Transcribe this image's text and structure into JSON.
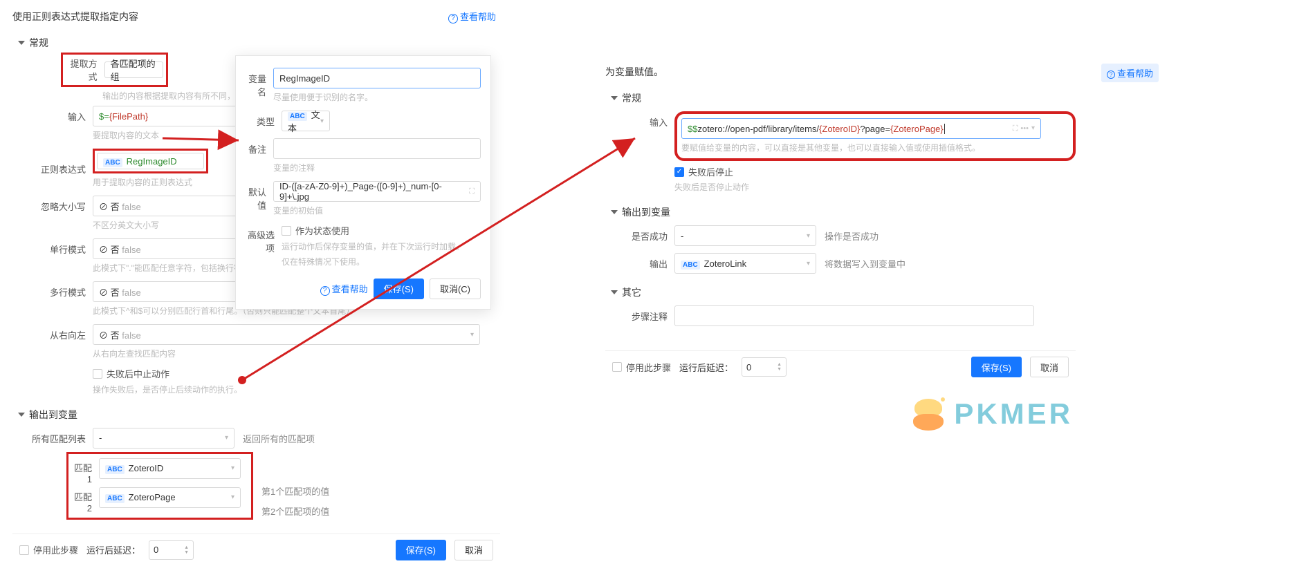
{
  "left": {
    "title": "使用正则表达式提取指定内容",
    "help": "查看帮助",
    "sec_general": "常规",
    "extract_mode_label": "提取方式",
    "extract_mode_value": "各匹配项的组",
    "extract_mode_hint": "输出的内容根据提取内容有所不同，请参考说明",
    "input_label": "输入",
    "input_prefix": "$=",
    "input_var": "{FilePath}",
    "input_hint": "要提取内容的文本",
    "regex_label": "正则表达式",
    "regex_badge": "ABC",
    "regex_value": "RegImageID",
    "regex_hint": "用于提取内容的正则表达式",
    "ignorecase_label": "忽略大小写",
    "val_no": "否",
    "val_false": "false",
    "ignorecase_hint": "不区分英文大小写",
    "singleline_label": "单行模式",
    "singleline_hint": "此模式下\".\"能匹配任意字符，包括换行符。",
    "multiline_label": "多行模式",
    "multiline_hint": "此模式下^和$可以分别匹配行首和行尾。（否则只能匹配整个文本首尾）",
    "rtl_label": "从右向左",
    "rtl_hint": "从右向左查找匹配内容",
    "stop_on_fail": "失败后中止动作",
    "stop_on_fail_hint": "操作失败后，是否停止后续动作的执行。",
    "sec_output": "输出到变量",
    "allmatch_label": "所有匹配列表",
    "allmatch_value": "-",
    "allmatch_hint": "返回所有的匹配项",
    "match1_label": "匹配1",
    "match1_value": "ZoteroID",
    "match1_hint": "第1个匹配项的值",
    "match2_label": "匹配2",
    "match2_value": "ZoteroPage",
    "match2_hint": "第2个匹配项的值",
    "disable_step": "停用此步骤",
    "delay_label": "运行后延迟：",
    "delay_value": "0",
    "save_btn": "保存(S)",
    "cancel_btn": "取消"
  },
  "modal": {
    "varname_label": "变量名",
    "varname_value": "RegImageID",
    "varname_hint": "尽量使用便于识别的名字。",
    "type_label": "类型",
    "type_badge": "ABC",
    "type_value": "文本",
    "remark_label": "备注",
    "remark_hint": "变量的注释",
    "default_label": "默认值",
    "default_value": "ID-([a-zA-Z0-9]+)_Page-([0-9]+)_num-[0-9]+\\.jpg",
    "default_hint": "变量的初始值",
    "adv_label": "高级选项",
    "adv_check": "作为状态使用",
    "adv_hint1": "运行动作后保存变量的值，并在下次运行时加载。",
    "adv_hint2": "仅在特殊情况下使用。",
    "help": "查看帮助",
    "save_btn": "保存(S)",
    "cancel_btn": "取消(C)"
  },
  "right": {
    "title": "为变量赋值。",
    "help": "查看帮助",
    "sec_general": "常规",
    "input_label": "输入",
    "input_p1": "$$",
    "input_p2": "zotero://open-pdf/library/items/",
    "input_p3": "{ZoteroID}",
    "input_p4": "?page=",
    "input_p5": "{ZoteroPage}",
    "input_hint": "要赋值给变量的内容，可以直接是其他变量，也可以直接输入值或使用插值格式。",
    "fail_stop": "失败后停止",
    "fail_stop_hint": "失败后是否停止动作",
    "sec_output": "输出到变量",
    "success_label": "是否成功",
    "success_value": "-",
    "success_hint": "操作是否成功",
    "output_label": "输出",
    "output_badge": "ABC",
    "output_value": "ZoteroLink",
    "output_hint": "将数据写入到变量中",
    "sec_other": "其它",
    "step_remark_label": "步骤注释",
    "disable_step": "停用此步骤",
    "delay_label": "运行后延迟：",
    "delay_value": "0",
    "save_btn": "保存(S)",
    "cancel_btn": "取消"
  },
  "watermark": "PKMER"
}
